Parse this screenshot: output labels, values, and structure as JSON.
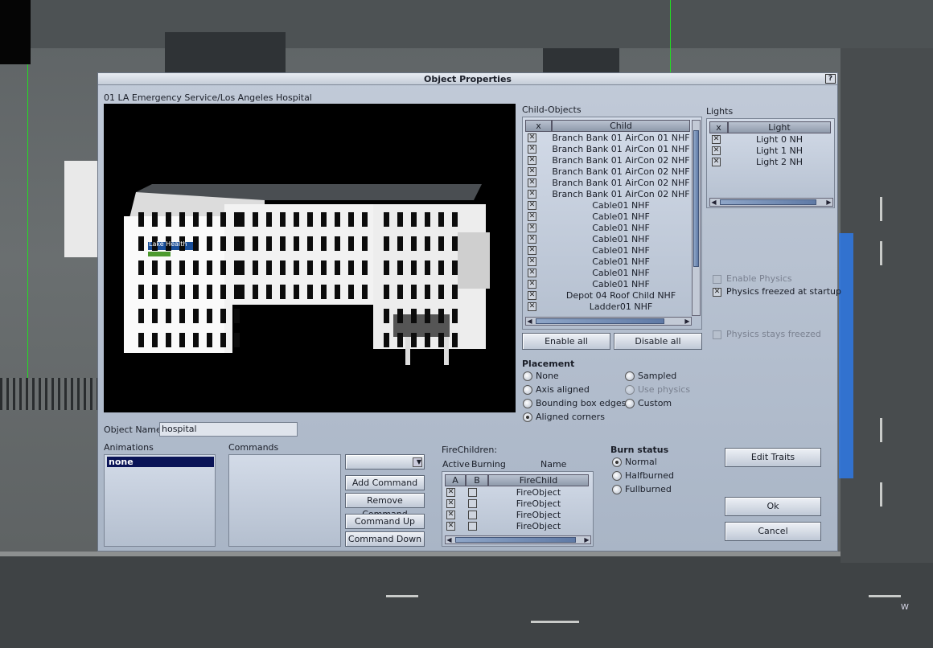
{
  "dialog": {
    "title": "Object Properties",
    "help_label": "?",
    "object_path": "01 LA Emergency Service/Los Angeles Hospital",
    "object_name_label": "Object Name:",
    "object_name_value": "hospital"
  },
  "child_objects": {
    "label": "Child-Objects",
    "col_x": "x",
    "col_child": "Child",
    "rows": [
      "Branch Bank 01 AirCon 01 NHF",
      "Branch Bank 01 AirCon 01 NHF",
      "Branch Bank 01 AirCon 02 NHF",
      "Branch Bank 01 AirCon 02 NHF",
      "Branch Bank 01 AirCon 02 NHF",
      "Branch Bank 01 AirCon 02 NHF",
      "Cable01 NHF",
      "Cable01 NHF",
      "Cable01 NHF",
      "Cable01 NHF",
      "Cable01 NHF",
      "Cable01 NHF",
      "Cable01 NHF",
      "Cable01 NHF",
      "Depot 04 Roof Child NHF",
      "Ladder01 NHF"
    ],
    "enable_all": "Enable all",
    "disable_all": "Disable all"
  },
  "lights": {
    "label": "Lights",
    "col_x": "x",
    "col_light": "Light",
    "rows": [
      "Light 0 NH",
      "Light 1 NH",
      "Light 2 NH"
    ]
  },
  "physics": {
    "enable_physics": "Enable Physics",
    "freezed_at_startup": "Physics freezed at startup",
    "stays_freezed": "Physics stays freezed"
  },
  "placement": {
    "label": "Placement",
    "none": "None",
    "axis_aligned": "Axis aligned",
    "bounding_box_edges": "Bounding box edges",
    "aligned_corners": "Aligned corners",
    "sampled": "Sampled",
    "use_physics": "Use physics",
    "custom": "Custom"
  },
  "animations": {
    "label": "Animations",
    "selected": "none"
  },
  "commands": {
    "label": "Commands",
    "add": "Add Command",
    "remove": "Remove Command",
    "up": "Command Up",
    "down": "Command Down"
  },
  "fire_children": {
    "label": "FireChildren:",
    "col_active": "Active",
    "col_burning": "Burning",
    "col_name": "Name",
    "hdr_a": "A",
    "hdr_b": "B",
    "hdr_firechild": "FireChild",
    "rows": [
      "FireObject",
      "FireObject",
      "FireObject",
      "FireObject"
    ]
  },
  "burn_status": {
    "label": "Burn status",
    "normal": "Normal",
    "halfburned": "Halfburned",
    "fullburned": "Fullburned"
  },
  "buttons": {
    "edit_traits": "Edit Traits",
    "ok": "Ok",
    "cancel": "Cancel"
  },
  "preview": {
    "sign_text": "Lake Health"
  },
  "scene": {
    "compass_label": "W"
  }
}
